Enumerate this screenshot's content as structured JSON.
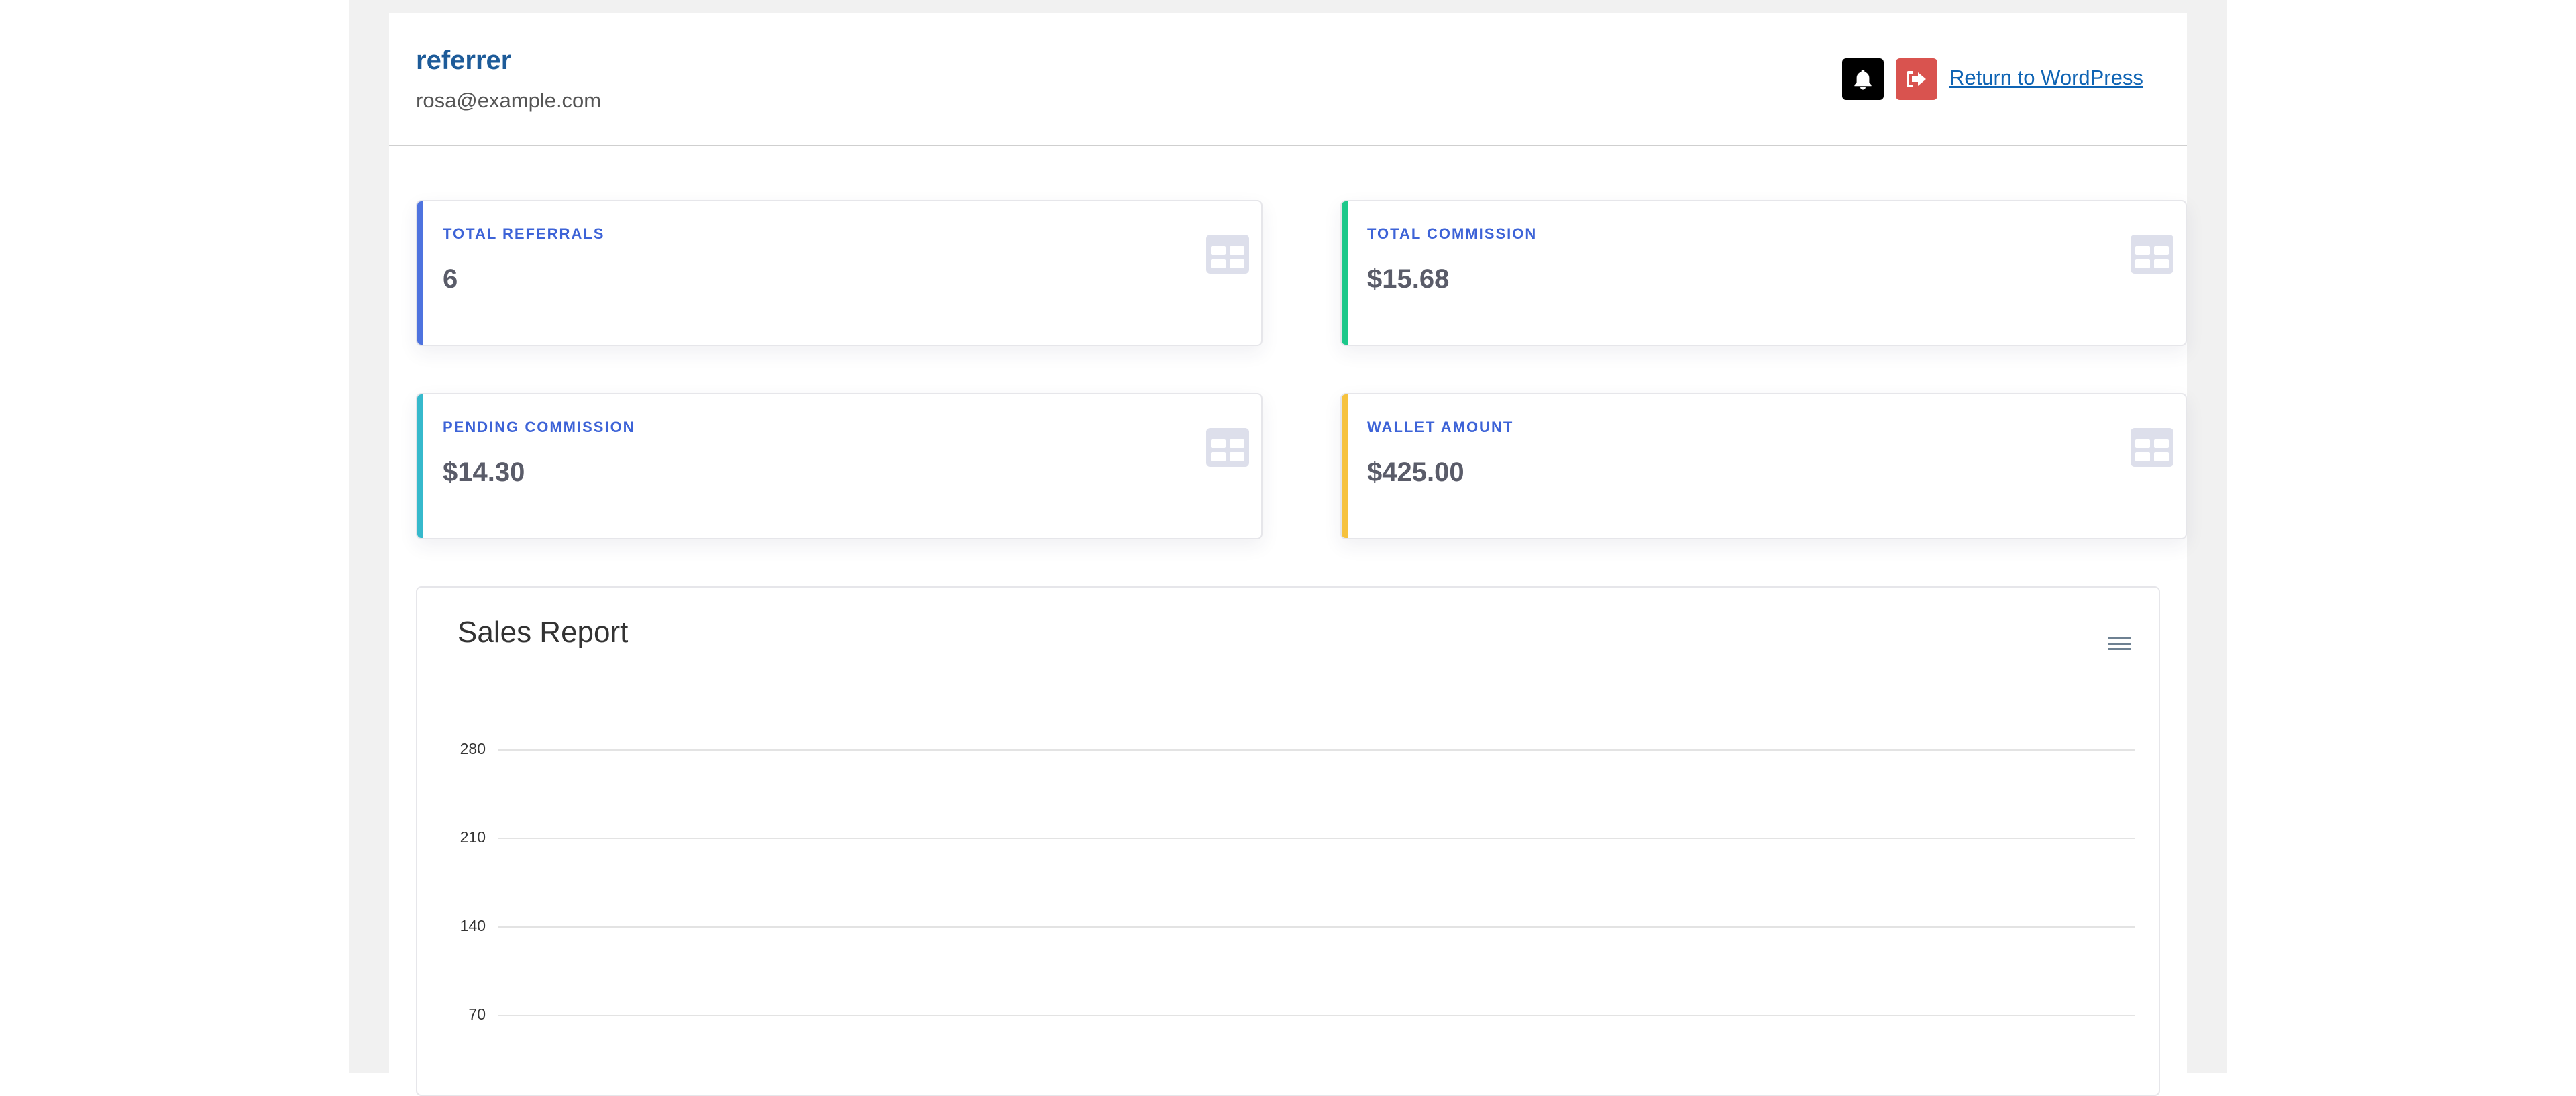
{
  "header": {
    "user_name": "referrer",
    "user_email": "rosa@example.com",
    "return_link": "Return to WordPress"
  },
  "cards": [
    {
      "label": "TOTAL REFERRALS",
      "value": "6",
      "accent": "#4e73df",
      "icon": "table-icon"
    },
    {
      "label": "TOTAL COMMISSION",
      "value": "$15.68",
      "accent": "#1cc88a",
      "icon": "table-icon"
    },
    {
      "label": "PENDING COMMISSION",
      "value": "$14.30",
      "accent": "#36b9cc",
      "icon": "table-icon"
    },
    {
      "label": "WALLET AMOUNT",
      "value": "$425.00",
      "accent": "#f6c23e",
      "icon": "table-icon"
    }
  ],
  "sales_report": {
    "title": "Sales Report",
    "menu_icon": "hamburger-menu-icon"
  },
  "chart_data": {
    "type": "line",
    "title": "Sales Report",
    "y_ticks": [
      280,
      210,
      140,
      70
    ],
    "grid": true,
    "series": []
  }
}
